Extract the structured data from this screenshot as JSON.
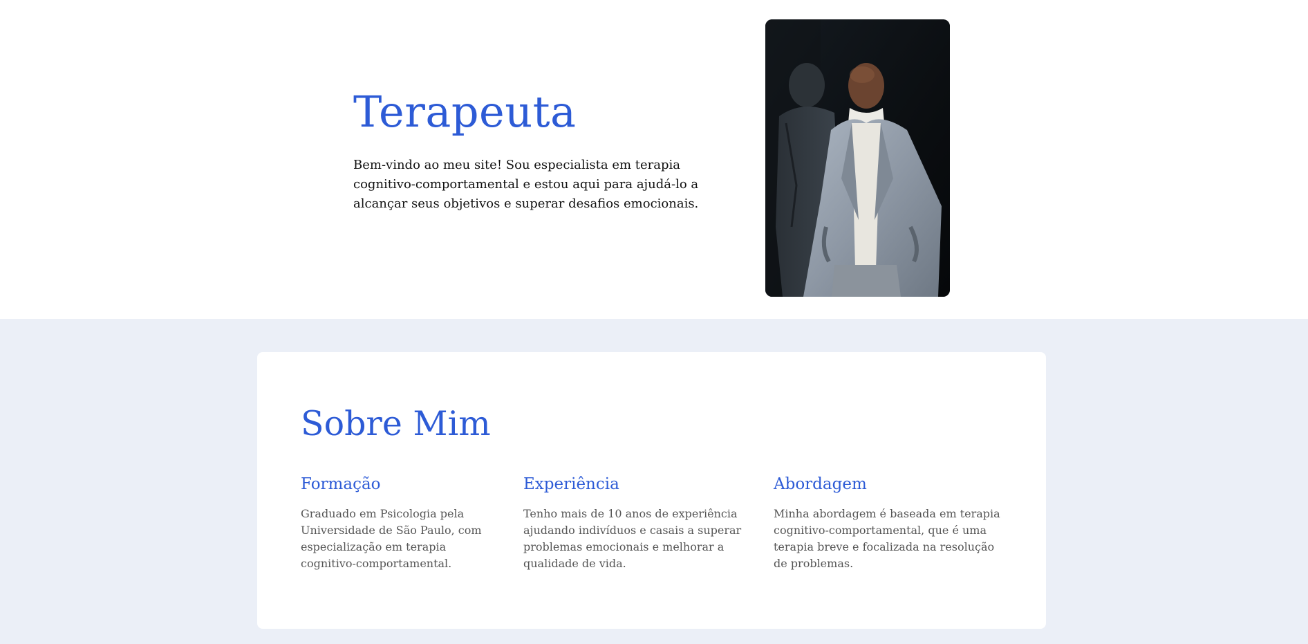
{
  "hero": {
    "title": "Terapeuta",
    "description": "Bem-vindo ao meu site! Sou especialista em terapia cognitivo-comportamental e estou aqui para ajudá-lo a alcançar seus objetivos e superar desafios emocionais."
  },
  "about": {
    "title": "Sobre Mim",
    "columns": [
      {
        "heading": "Formação",
        "text": "Graduado em Psicologia pela Universidade de São Paulo, com especialização em terapia cognitivo-comportamental."
      },
      {
        "heading": "Experiência",
        "text": "Tenho mais de 10 anos de experiência ajudando indivíduos e casais a superar problemas emocionais e melhorar a qualidade de vida."
      },
      {
        "heading": "Abordagem",
        "text": "Minha abordagem é baseada em terapia cognitivo-comportamental, que é uma terapia breve e focalizada na resolução de problemas."
      }
    ]
  },
  "colors": {
    "accent": "#2d5bd6",
    "section_background": "#ebeff7",
    "card_background": "#ffffff",
    "body_text": "#111111",
    "muted_text": "#555555"
  }
}
